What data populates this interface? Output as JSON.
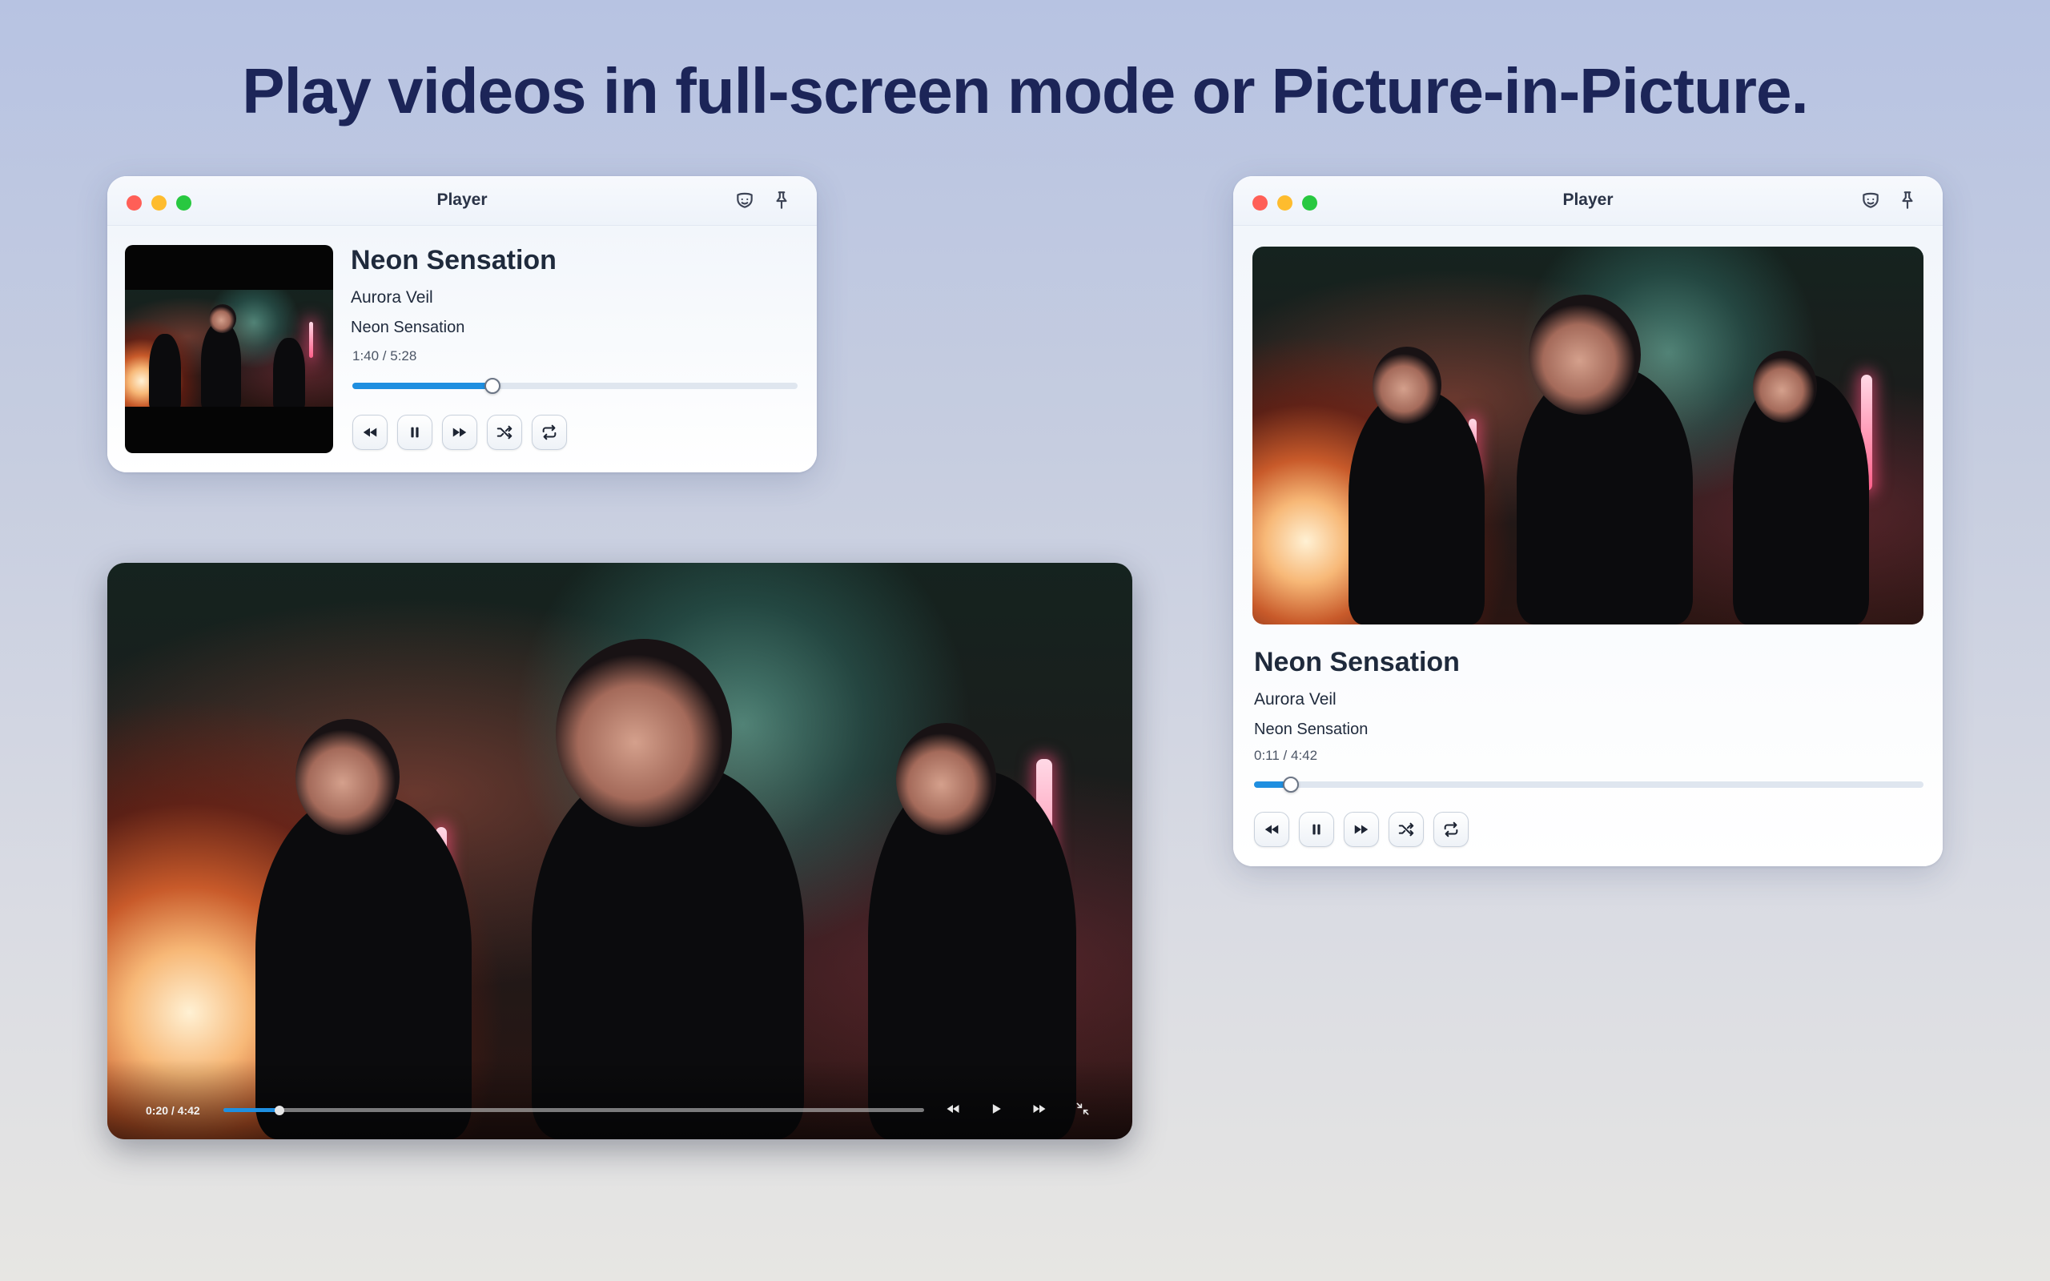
{
  "headline": "Play videos in full-screen mode or Picture-in-Picture.",
  "mini_player": {
    "window_title": "Player",
    "toolbar_icons": [
      "theme-icon",
      "pin-icon"
    ],
    "track_title": "Neon Sensation",
    "artist": "Aurora Veil",
    "album": "Neon Sensation",
    "time": "1:40 / 5:28",
    "progress_fraction": 0.315,
    "controls": [
      "rewind-icon",
      "pause-icon",
      "fast-forward-icon",
      "shuffle-icon",
      "repeat-icon"
    ]
  },
  "big_player": {
    "window_title": "Player",
    "toolbar_icons": [
      "theme-icon",
      "pin-icon"
    ],
    "track_title": "Neon Sensation",
    "artist": "Aurora Veil",
    "album": "Neon Sensation",
    "time": "0:11 / 4:42",
    "progress_fraction": 0.055,
    "controls": [
      "rewind-icon",
      "pause-icon",
      "fast-forward-icon",
      "shuffle-icon",
      "repeat-icon"
    ]
  },
  "fullscreen_player": {
    "time": "0:20 / 4:42",
    "progress_fraction": 0.08,
    "controls": [
      "rewind-icon",
      "play-icon",
      "fast-forward-icon",
      "exit-fullscreen-icon"
    ]
  },
  "colors": {
    "accent": "#1f8fe0",
    "headline": "#1c2558",
    "traffic_red": "#ff5f57",
    "traffic_yellow": "#febc2e",
    "traffic_green": "#28c840"
  }
}
